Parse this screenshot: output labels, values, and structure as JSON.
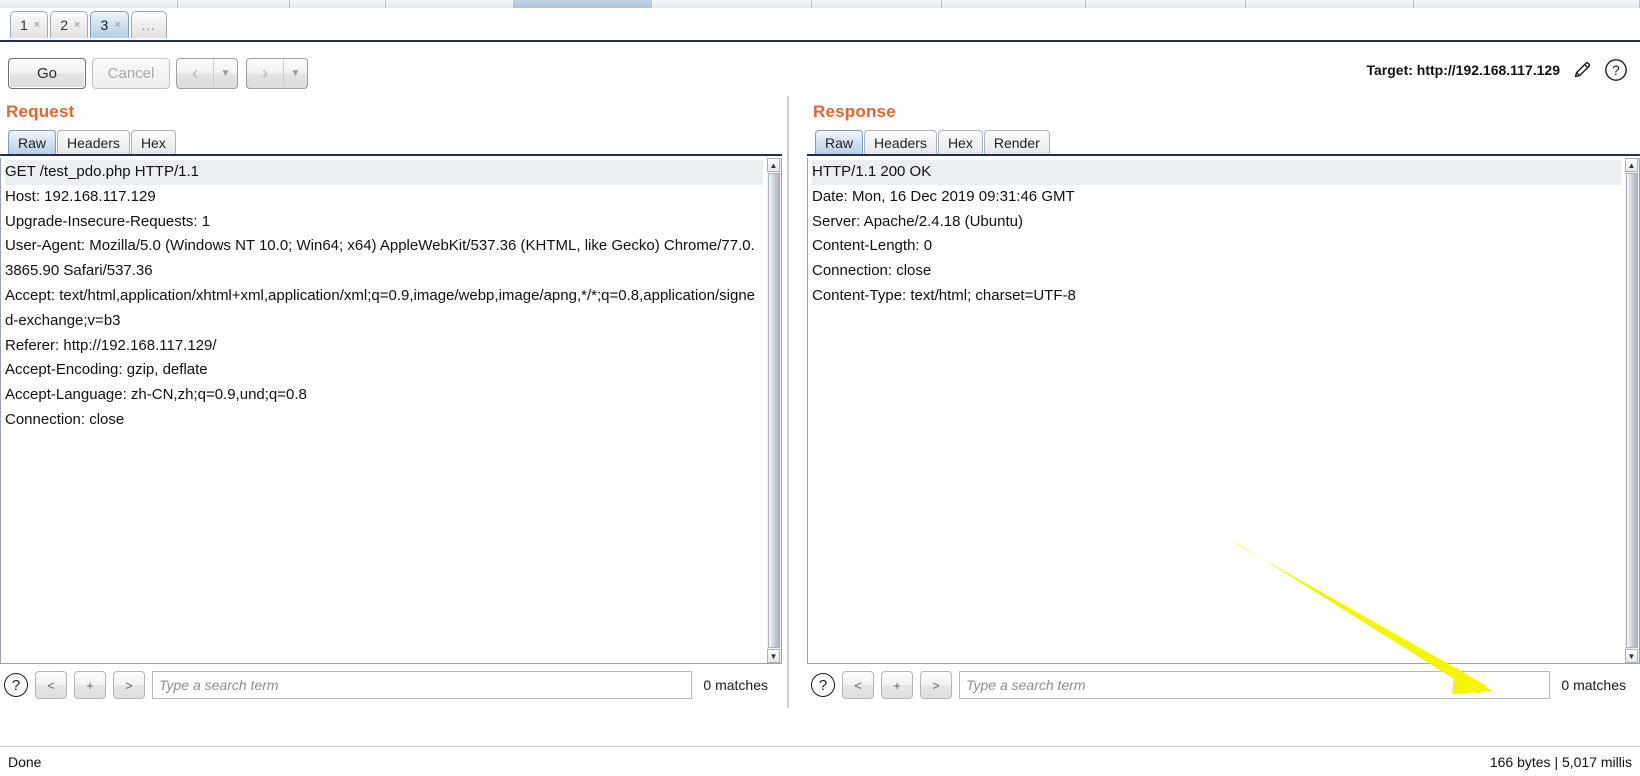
{
  "window": {
    "main_tabs_partial": [
      "",
      "",
      "",
      "",
      "",
      "",
      "",
      "",
      ""
    ],
    "main_tab_selected_index": 4
  },
  "repeater_tabs": {
    "items": [
      {
        "label": "1",
        "close": "×",
        "active": false
      },
      {
        "label": "2",
        "close": "×",
        "active": false
      },
      {
        "label": "3",
        "close": "×",
        "active": true
      }
    ],
    "overflow_label": "..."
  },
  "toolbar": {
    "go_label": "Go",
    "cancel_label": "Cancel",
    "back_arrow": "‹",
    "back_caret": "▼",
    "forward_arrow": "›",
    "forward_caret": "▼",
    "target_label": "Target: http://192.168.117.129",
    "edit_icon": "pencil-icon",
    "help_icon": "?"
  },
  "request": {
    "title": "Request",
    "tabs": [
      {
        "label": "Raw",
        "active": true
      },
      {
        "label": "Headers",
        "active": false
      },
      {
        "label": "Hex",
        "active": false
      }
    ],
    "lines": [
      "GET /test_pdo.php HTTP/1.1",
      "Host: 192.168.117.129",
      "Upgrade-Insecure-Requests: 1",
      "User-Agent: Mozilla/5.0 (Windows NT 10.0; Win64; x64) AppleWebKit/537.36 (KHTML, like Gecko) Chrome/77.0.3865.90 Safari/537.36",
      "Accept: text/html,application/xhtml+xml,application/xml;q=0.9,image/webp,image/apng,*/*;q=0.8,application/signed-exchange;v=b3",
      "Referer: http://192.168.117.129/",
      "Accept-Encoding: gzip, deflate",
      "Accept-Language: zh-CN,zh;q=0.9,und;q=0.8",
      "Connection: close"
    ],
    "find": {
      "help_icon": "?",
      "prev_label": "<",
      "add_label": "+",
      "next_label": ">",
      "placeholder": "Type a search term",
      "value": "",
      "matches": "0 matches"
    }
  },
  "response": {
    "title": "Response",
    "tabs": [
      {
        "label": "Raw",
        "active": true
      },
      {
        "label": "Headers",
        "active": false
      },
      {
        "label": "Hex",
        "active": false
      },
      {
        "label": "Render",
        "active": false
      }
    ],
    "lines": [
      "HTTP/1.1 200 OK",
      "Date: Mon, 16 Dec 2019 09:31:46 GMT",
      "Server: Apache/2.4.18 (Ubuntu)",
      "Content-Length: 0",
      "Connection: close",
      "Content-Type: text/html; charset=UTF-8"
    ],
    "find": {
      "help_icon": "?",
      "prev_label": "<",
      "add_label": "+",
      "next_label": ">",
      "placeholder": "Type a search term",
      "value": "",
      "matches": "0 matches"
    }
  },
  "status_bar": {
    "left": "Done",
    "right": "166 bytes | 5,017 millis"
  },
  "annotation": {
    "type": "arrow",
    "color": "#f5f500",
    "points_to": "response-find-matches"
  },
  "colors": {
    "pane_title": "#e8642c",
    "tab_active": "#b8cfe5",
    "underline": "#20304e",
    "annotation": "#f5f500"
  }
}
